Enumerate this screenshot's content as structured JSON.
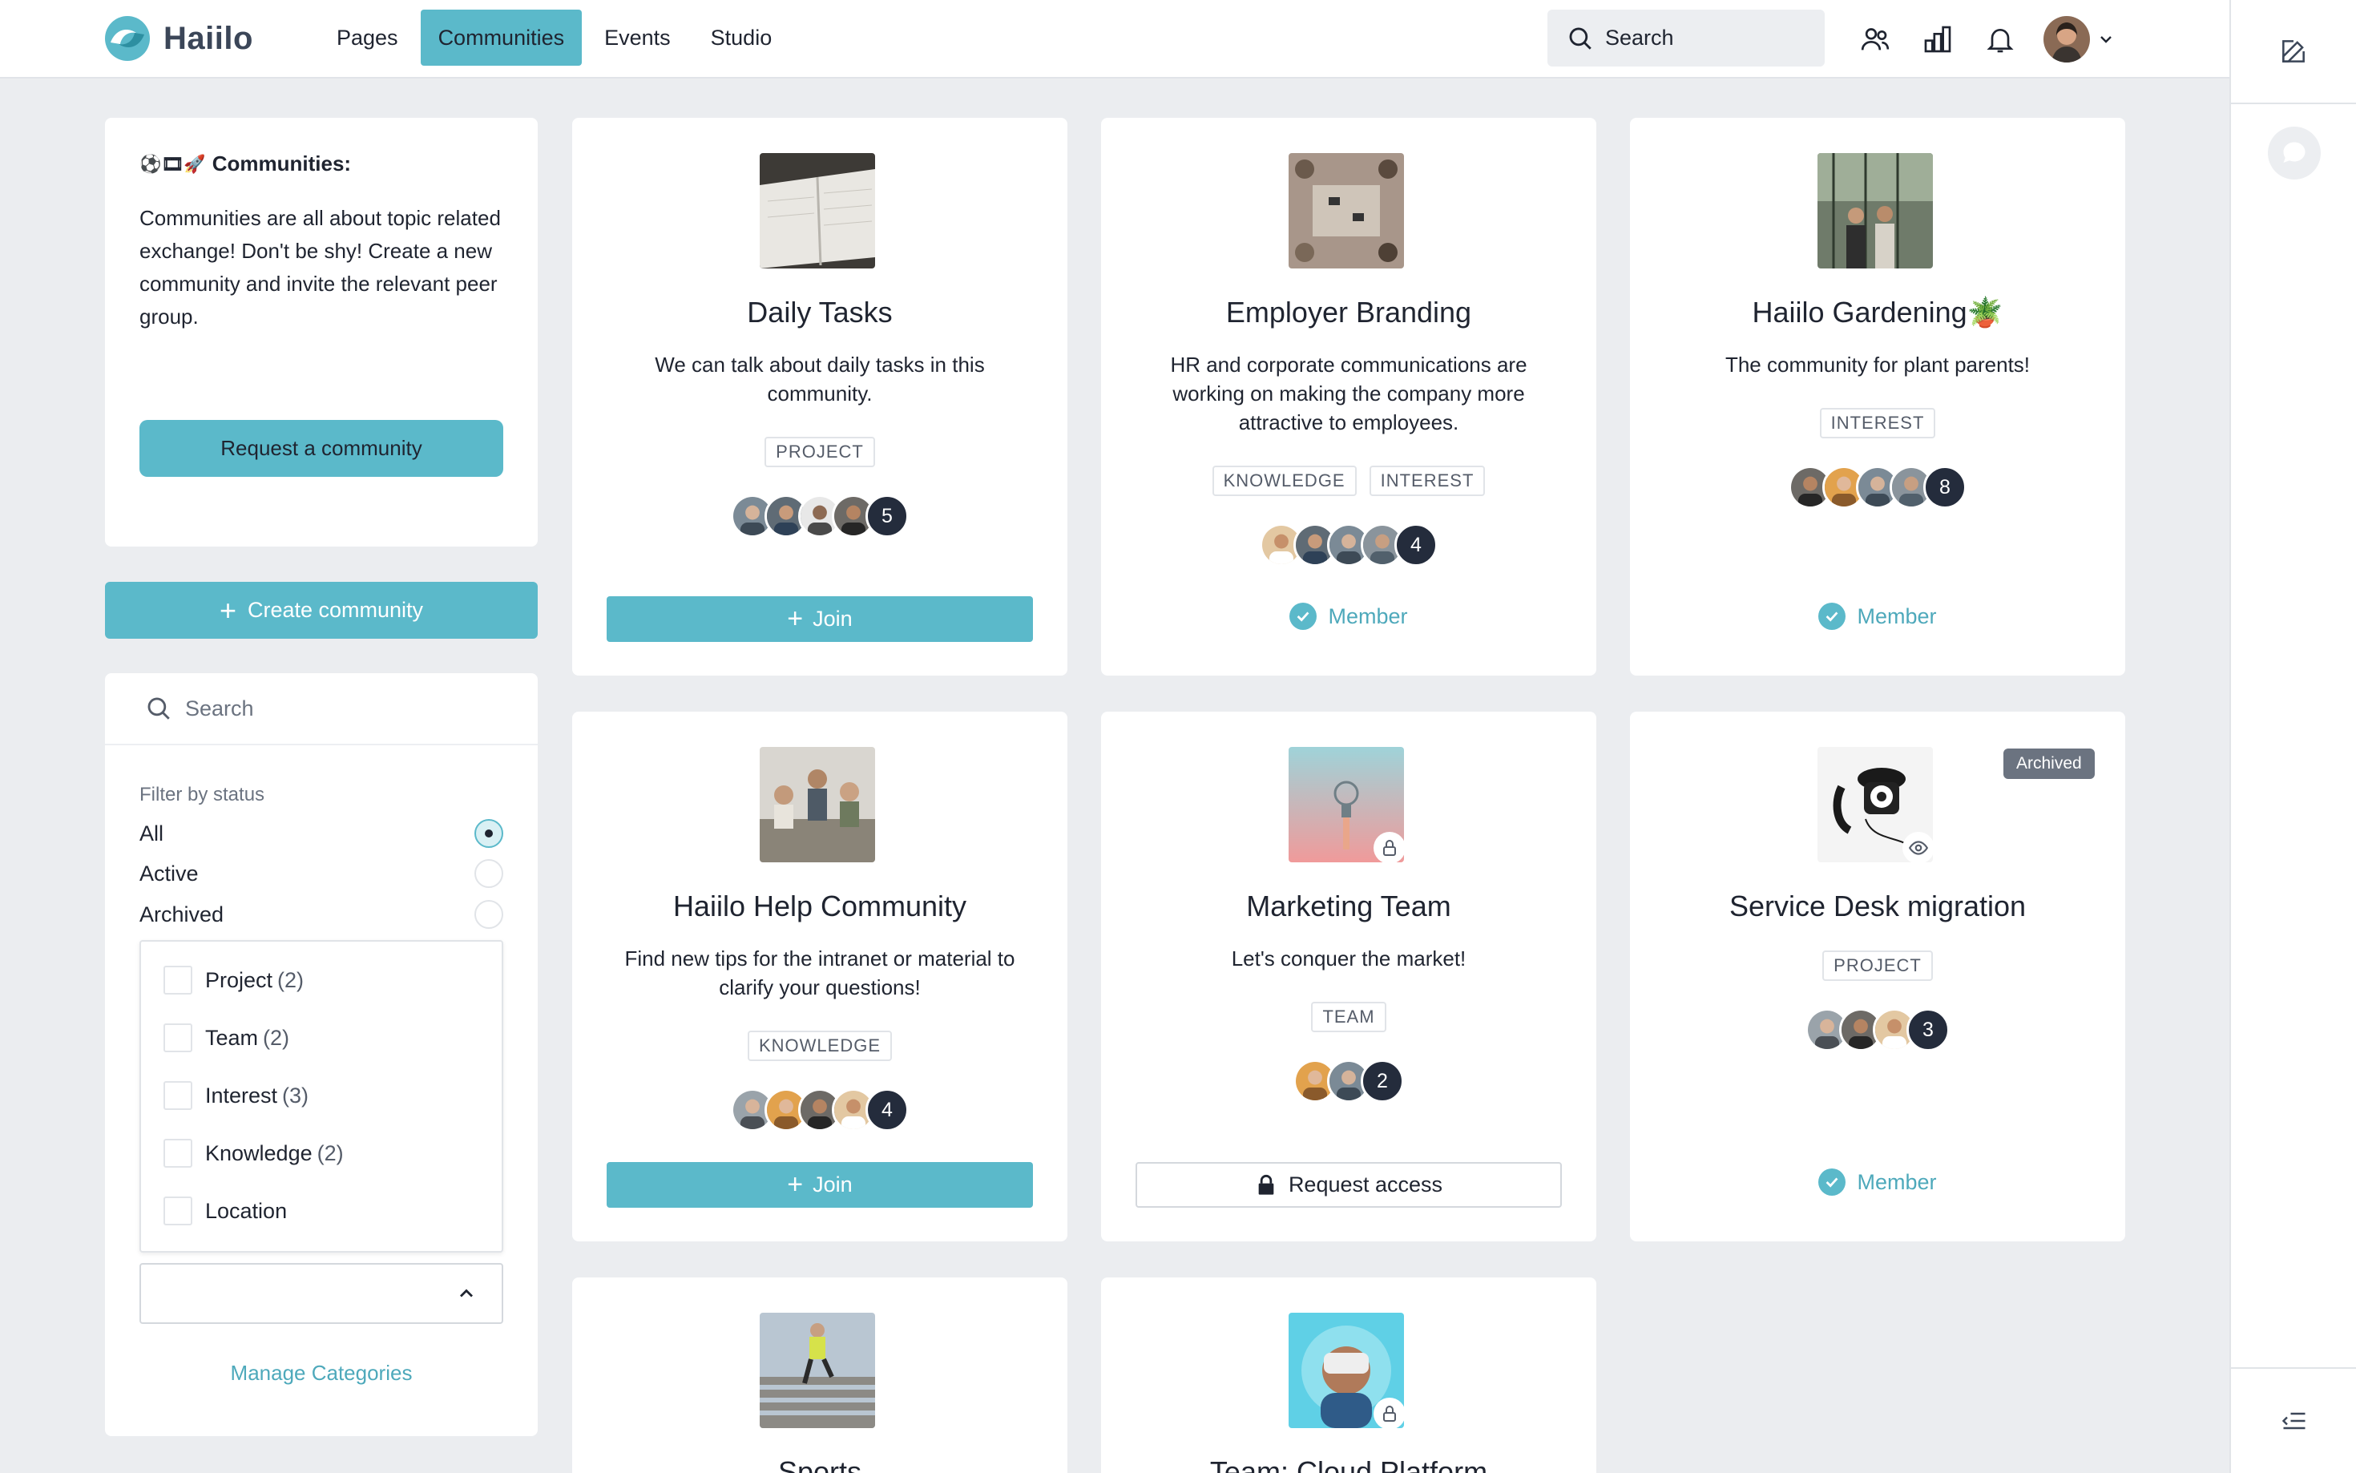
{
  "header": {
    "app_name": "Haiilo",
    "nav": [
      "Pages",
      "Communities",
      "Events",
      "Studio"
    ],
    "active_nav": "Communities",
    "search_label": "Search"
  },
  "intro": {
    "emoji": "⚽️🎞🚀",
    "title": "Communities:",
    "text": "Communities are all about topic related exchange! Don't be shy! Create a new community and invite the relevant peer group.",
    "request_button": "Request a community"
  },
  "create_button": "Create community",
  "filter": {
    "search_placeholder": "Search",
    "status_label": "Filter by status",
    "statuses": [
      "All",
      "Active",
      "Archived"
    ],
    "selected_status": "All",
    "categories": [
      {
        "name": "Project",
        "count": "(2)"
      },
      {
        "name": "Team",
        "count": "(2)"
      },
      {
        "name": "Interest",
        "count": "(3)"
      },
      {
        "name": "Knowledge",
        "count": "(2)"
      },
      {
        "name": "Location",
        "count": ""
      }
    ],
    "manage_label": "Manage Categories"
  },
  "cards": [
    {
      "title": "Daily Tasks",
      "description": "We can talk about daily tasks in this community.",
      "tags": [
        "PROJECT"
      ],
      "member_count": "5",
      "action": "Join"
    },
    {
      "title": "Employer Branding",
      "description": "HR and corporate communications are working on making the company more attractive to employees.",
      "tags": [
        "KNOWLEDGE",
        "INTEREST"
      ],
      "member_count": "4",
      "action": "Member"
    },
    {
      "title": "Haiilo Gardening🪴",
      "description": "The community for plant parents!",
      "tags": [
        "INTEREST"
      ],
      "member_count": "8",
      "action": "Member"
    },
    {
      "title": "Haiilo Help Community",
      "description": "Find new tips for the intranet or material to clarify your questions!",
      "tags": [
        "KNOWLEDGE"
      ],
      "member_count": "4",
      "action": "Join"
    },
    {
      "title": "Marketing Team",
      "description": "Let's conquer the market!",
      "tags": [
        "TEAM"
      ],
      "member_count": "2",
      "action": "Request access"
    },
    {
      "title": "Service Desk migration",
      "description": "",
      "tags": [
        "PROJECT"
      ],
      "member_count": "3",
      "action": "Member",
      "badge": "Archived"
    },
    {
      "title": "Sports",
      "description": "",
      "tags": [],
      "member_count": "",
      "action": ""
    },
    {
      "title": "Team: Cloud Platform",
      "description": "",
      "tags": [],
      "member_count": "",
      "action": ""
    }
  ],
  "colors": {
    "accent": "#5bb9ca",
    "accent_text": "#4ea9bb",
    "dark": "#242c3c",
    "background": "#ebedf0"
  },
  "icons": [
    "people-icon",
    "chart-icon",
    "bell-icon",
    "edit-icon",
    "chat-icon",
    "menu-collapse-icon"
  ]
}
